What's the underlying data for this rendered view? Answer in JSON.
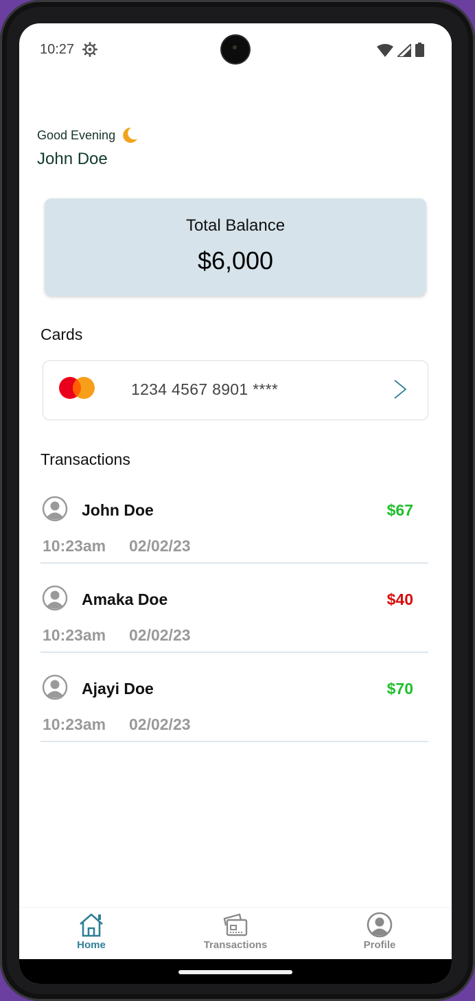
{
  "status_bar": {
    "time": "10:27",
    "icons": [
      "settings-gear-icon",
      "wifi-icon",
      "signal-icon",
      "battery-icon"
    ]
  },
  "header": {
    "greeting": "Good Evening",
    "greeting_icon": "crescent-moon-icon",
    "user_name": "John Doe"
  },
  "balance": {
    "label": "Total Balance",
    "amount": "$6,000"
  },
  "cards": {
    "title": "Cards",
    "items": [
      {
        "brand_icon": "mastercard-icon",
        "number": "1234 4567 8901 ****"
      }
    ]
  },
  "transactions": {
    "title": "Transactions",
    "items": [
      {
        "name": "John Doe",
        "amount": "$67",
        "time": "10:23am",
        "date": "02/02/23",
        "color": "#1fbf2b"
      },
      {
        "name": "Amaka Doe",
        "amount": "$40",
        "time": "10:23am",
        "date": "02/02/23",
        "color": "#d80c0c"
      },
      {
        "name": "Ajayi Doe",
        "amount": "$70",
        "time": "10:23am",
        "date": "02/02/23",
        "color": "#1fbf2b"
      }
    ]
  },
  "bottom_nav": {
    "items": [
      {
        "label": "Home",
        "icon": "home-icon",
        "active": true
      },
      {
        "label": "Transactions",
        "icon": "transactions-icon",
        "active": false
      },
      {
        "label": "Profile",
        "icon": "profile-icon",
        "active": false
      }
    ]
  },
  "colors": {
    "accent": "#2f7e97",
    "inactive": "#8a8a8a",
    "balance_card": "#d6e3eb",
    "positive": "#1fbf2b",
    "negative": "#d80c0c"
  }
}
